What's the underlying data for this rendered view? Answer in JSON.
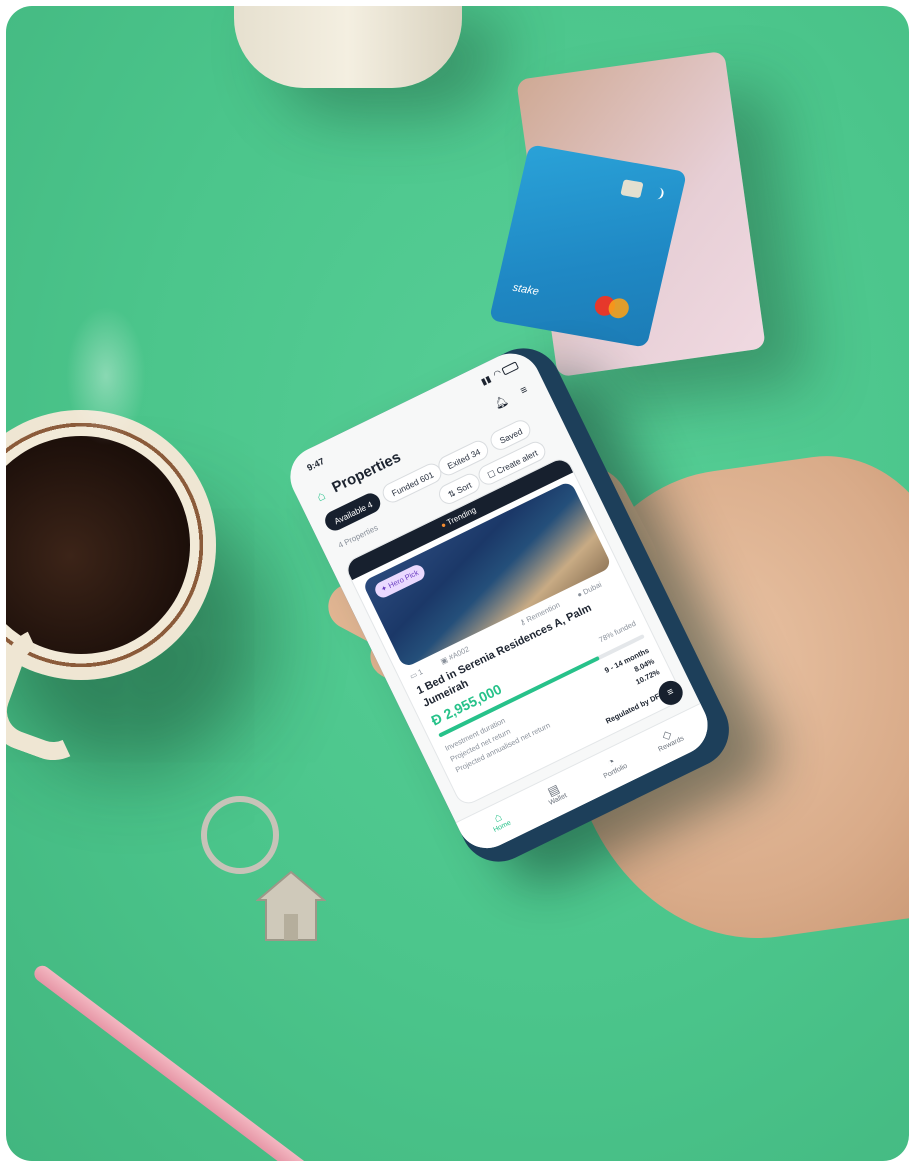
{
  "phone": {
    "time": "9:47",
    "title": "Properties",
    "filters": [
      {
        "label": "Available 4",
        "active": true
      },
      {
        "label": "Funded 601",
        "active": false
      },
      {
        "label": "Exited 34",
        "active": false
      },
      {
        "label": "Saved",
        "active": false
      }
    ],
    "count_label": "4 Properties",
    "sort_label": "Sort",
    "alert_label": "Create alert",
    "card": {
      "badge": "Trending",
      "tag": "Hero Pick",
      "location_a": "Remention",
      "location_b": "Dubai",
      "beds": "1",
      "ref": "#A002",
      "title": "1 Bed in Serenia Residences A, Palm Jumeirah",
      "price": "2,955,000",
      "funded": "78% funded",
      "funded_fraction": 0.78,
      "duration_label": "Investment duration",
      "duration_value": "9 - 14 months",
      "yield_label": "Projected net return",
      "yield_value": "8.04%",
      "annual_label": "Projected annualised net return",
      "annual_value": "10.72%",
      "regulated": "Regulated by DFSA"
    },
    "nav": [
      {
        "label": "Home",
        "active": true
      },
      {
        "label": "Wallet",
        "active": false
      },
      {
        "label": "Portfolio",
        "active": false
      },
      {
        "label": "Rewards",
        "active": false
      }
    ],
    "colors": {
      "accent": "#27c28a",
      "dark": "#17202e"
    }
  },
  "card_brand": "stake"
}
